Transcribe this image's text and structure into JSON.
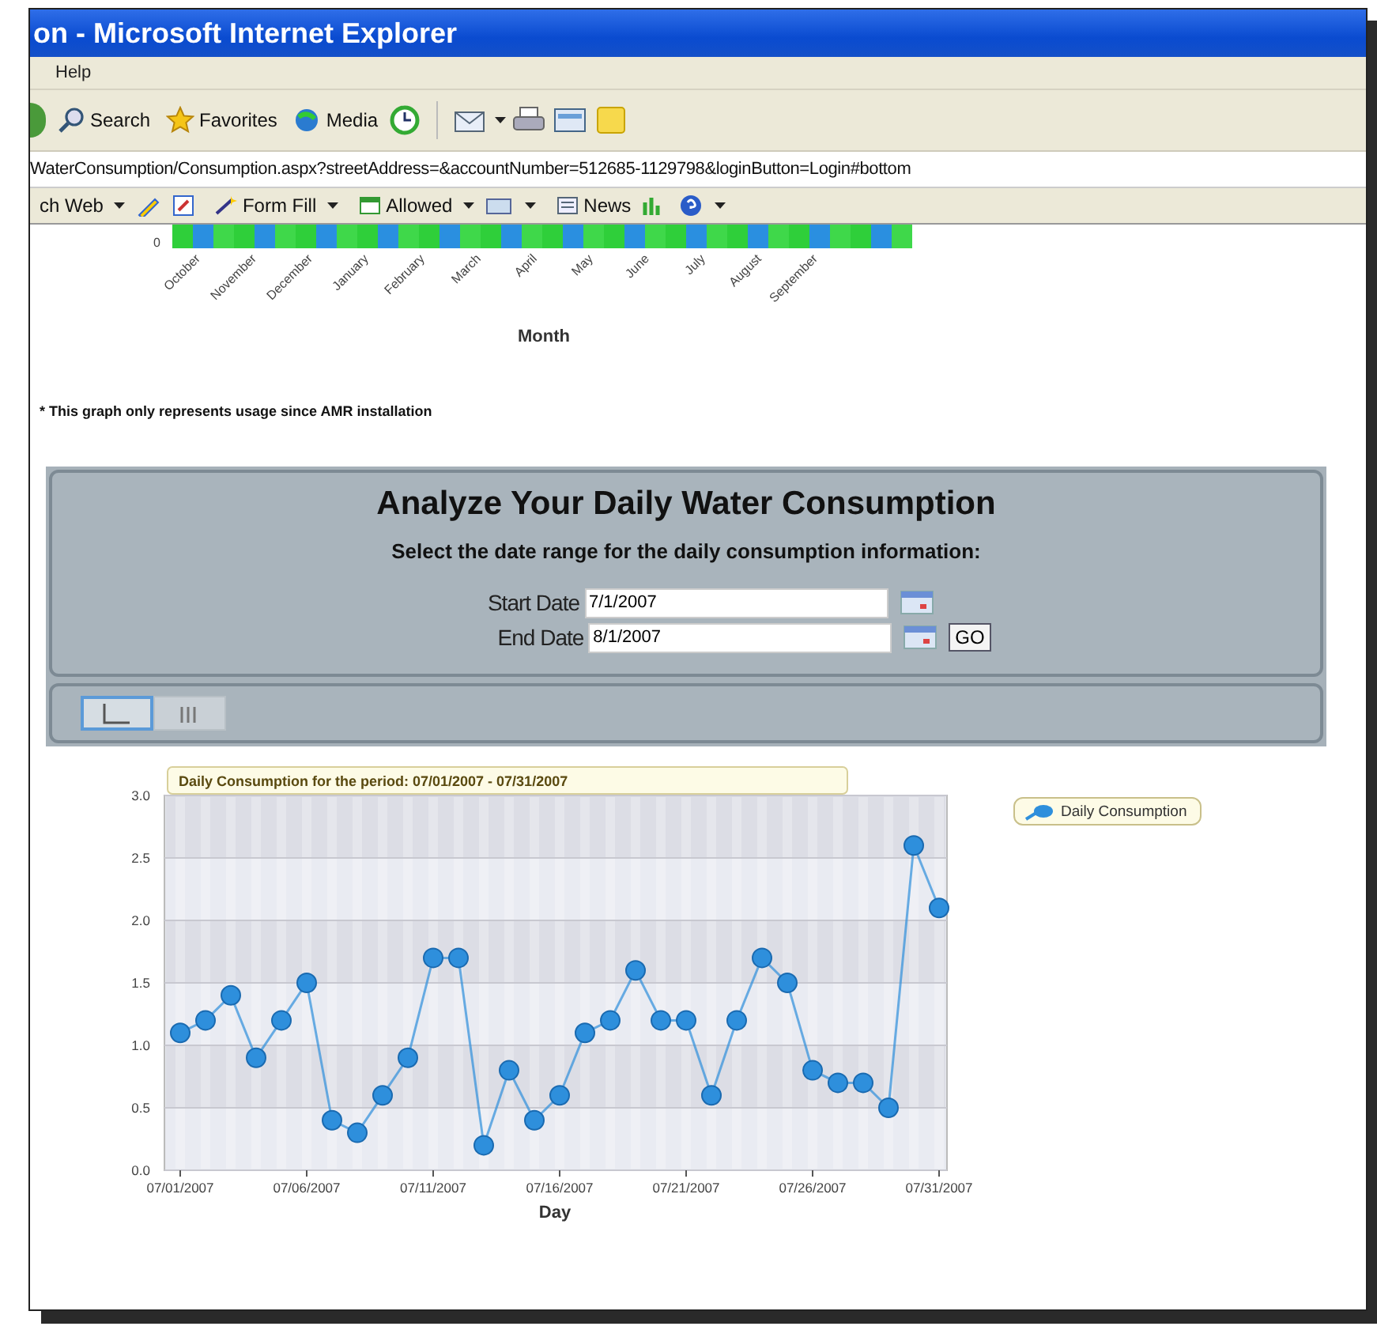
{
  "window": {
    "title": "on - Microsoft Internet Explorer"
  },
  "menu": [
    "Help"
  ],
  "toolbar": [
    {
      "label": "Search",
      "kind": "search"
    },
    {
      "label": "Favorites",
      "kind": "star"
    },
    {
      "label": "Media",
      "kind": "media"
    }
  ],
  "address": "WaterConsumption/Consumption.aspx?streetAddress=&accountNumber=512685-1129798&loginButton=Login#bottom",
  "links_bar": [
    {
      "label": "ch Web",
      "kind": "dropdown"
    },
    {
      "label": "Form Fill",
      "kind": "dropdown"
    },
    {
      "label": "Allowed",
      "kind": "dropdown"
    },
    {
      "label": "News",
      "kind": "plain"
    }
  ],
  "monthly_graph": {
    "zero_label": "0",
    "months": [
      "October",
      "November",
      "December",
      "January",
      "February",
      "March",
      "April",
      "May",
      "June",
      "July",
      "August",
      "September"
    ],
    "xlabel": "Month",
    "note": "* This graph only represents usage since AMR installation"
  },
  "analyze": {
    "title": "Analyze Your Daily Water Consumption",
    "subtitle": "Select the date range for the daily consumption information:",
    "fields": [
      {
        "label": "Start Date",
        "value": "7/1/2007"
      },
      {
        "label": "End Date",
        "value": "8/1/2007"
      }
    ],
    "go": "GO",
    "views": [
      {
        "kind": "line",
        "selected": true
      },
      {
        "kind": "bar",
        "selected": false
      }
    ]
  },
  "daily_chart": {
    "chart_data": {
      "type": "line",
      "title": "Daily Consumption for the period: 07/01/2007 - 07/31/2007",
      "xlabel": "Day",
      "categories": [
        "07/01/2007",
        null,
        null,
        null,
        null,
        "07/06/2007",
        null,
        null,
        null,
        null,
        "07/11/2007",
        null,
        null,
        null,
        null,
        "07/16/2007",
        null,
        null,
        null,
        null,
        "07/21/2007",
        null,
        null,
        null,
        null,
        "07/26/2007",
        null,
        null,
        null,
        null,
        "07/31/2007"
      ],
      "grid": true,
      "series": [
        {
          "name": "Daily Consumption",
          "color": "#2e8fdc",
          "marker": "circle",
          "values": [
            1.1,
            1.2,
            1.4,
            0.9,
            1.2,
            1.5,
            0.4,
            0.3,
            0.6,
            0.9,
            1.7,
            1.7,
            0.2,
            0.8,
            0.4,
            0.6,
            1.1,
            1.2,
            1.6,
            1.2,
            1.2,
            0.6,
            1.2,
            1.7,
            1.5,
            0.8,
            0.7,
            0.7,
            0.5,
            2.6,
            2.1
          ]
        }
      ],
      "ylim": [
        0,
        3
      ],
      "yticks": [
        {
          "value": 0,
          "label": "0.0"
        },
        {
          "value": 0.5,
          "label": "0.5"
        },
        {
          "value": 1,
          "label": "1.0"
        },
        {
          "value": 1.5,
          "label": "1.5"
        },
        {
          "value": 2,
          "label": "2.0"
        },
        {
          "value": 2.5,
          "label": "2.5"
        },
        {
          "value": 3,
          "label": "3.0"
        }
      ]
    }
  }
}
